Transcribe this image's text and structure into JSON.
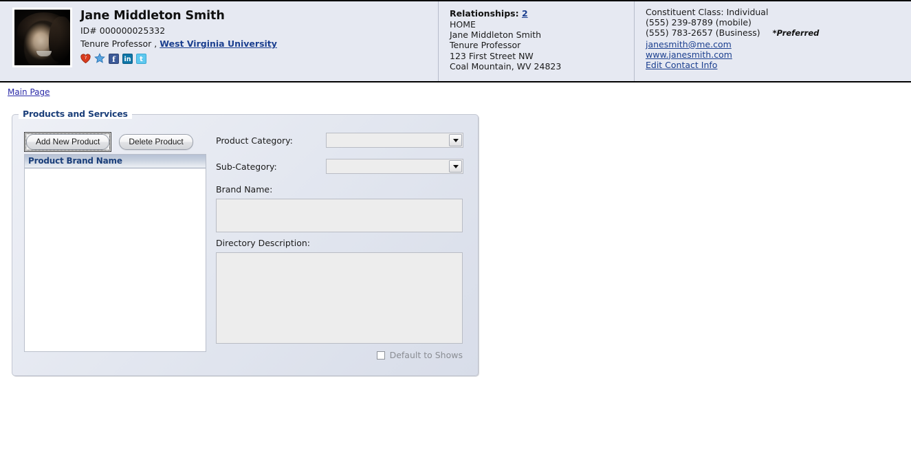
{
  "header": {
    "identity": {
      "avatar_alt": "portrait-photo",
      "name": "Jane Middleton Smith",
      "id_label": "ID# 000000025332",
      "title": "Tenure Professor ,",
      "organization": "West Virginia University",
      "social_icons": [
        {
          "name": "heart-icon",
          "glyph": "♥"
        },
        {
          "name": "star-icon",
          "glyph": "★"
        },
        {
          "name": "facebook-icon",
          "glyph": "f"
        },
        {
          "name": "linkedin-icon",
          "glyph": "in"
        },
        {
          "name": "twitter-icon",
          "glyph": "t"
        }
      ]
    },
    "relationships": {
      "label": "Relationships:",
      "count": "2",
      "lines": [
        "HOME",
        "Jane Middleton Smith",
        "Tenure Professor",
        "123 First Street NW",
        "Coal Mountain, WV 24823"
      ]
    },
    "contact": {
      "constituent_class": "Constituent Class: Individual",
      "phone_mobile": "(555) 239-8789 (mobile)",
      "phone_business": "(555) 783-2657 (Business)",
      "preferred_flag": "*Preferred",
      "email": "janesmith@me.com",
      "website": "www.janesmith.com",
      "edit_link": "Edit Contact Info"
    }
  },
  "breadcrumb": {
    "main_page": "Main Page"
  },
  "panel": {
    "legend": "Products and Services",
    "buttons": {
      "add": "Add New Product",
      "delete": "Delete Product"
    },
    "list": {
      "column_header": "Product Brand Name",
      "rows": []
    },
    "form": {
      "product_category_label": "Product Category:",
      "product_category_value": "",
      "sub_category_label": "Sub-Category:",
      "sub_category_value": "",
      "brand_name_label": "Brand Name:",
      "brand_name_value": "",
      "directory_description_label": "Directory Description:",
      "directory_description_value": "",
      "default_to_shows_label": "Default to Shows",
      "default_to_shows_checked": false
    }
  },
  "colors": {
    "header_bg": "#e6e9f2",
    "link": "#1b3f8f",
    "legend": "#1b3f7a",
    "panel_bg": "#e3e7f0",
    "field_bg": "#ededed"
  }
}
